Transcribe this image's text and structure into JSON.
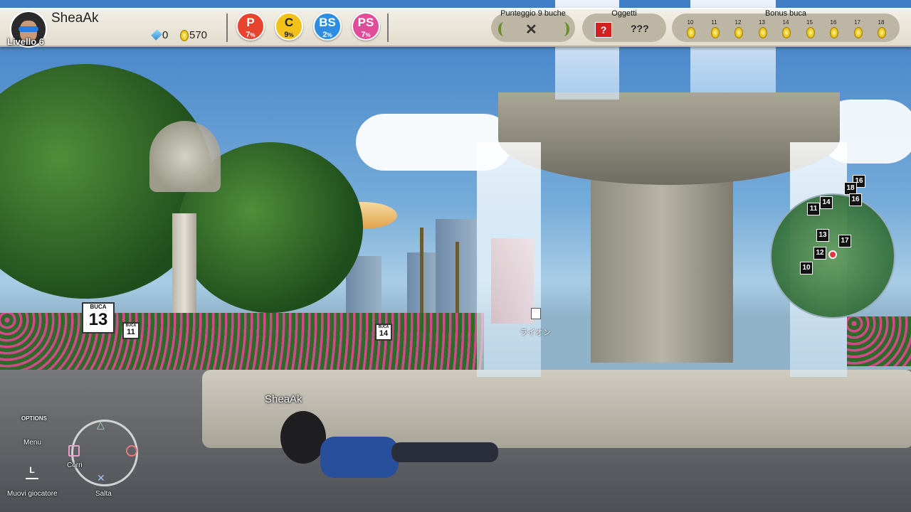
{
  "player": {
    "name": "SheaAk",
    "level_label": "Livello 6",
    "gems": "0",
    "coins": "570",
    "avatar_icon": "player-avatar-sunglasses"
  },
  "stats": [
    {
      "letter": "P",
      "value": "7",
      "unit": "%",
      "color": "#e8432f"
    },
    {
      "letter": "C",
      "value": "9",
      "unit": "%",
      "color": "#f3c21a"
    },
    {
      "letter": "BS",
      "value": "2",
      "unit": "%",
      "color": "#2e8de0"
    },
    {
      "letter": "PS",
      "value": "7",
      "unit": "%",
      "color": "#e04b9a"
    }
  ],
  "score_panel": {
    "label": "Punteggio 9 buche",
    "value_icon": "cross-icon"
  },
  "items_panel": {
    "label": "Oggetti",
    "item_icon": "question-block-icon",
    "value": "???"
  },
  "bonus_panel": {
    "label": "Bonus buca",
    "holes": [
      "10",
      "11",
      "12",
      "13",
      "14",
      "15",
      "16",
      "17",
      "18"
    ]
  },
  "world": {
    "player_tag": "SheaAk",
    "npc_name": "ライオン",
    "sign_big": {
      "caption": "BUCA",
      "number": "13"
    },
    "sign_small": [
      {
        "caption": "BUCA",
        "number": "11"
      },
      {
        "caption": "BUCA",
        "number": "14"
      }
    ]
  },
  "minimap": {
    "markers": [
      "16",
      "18",
      "16",
      "11",
      "14",
      "13",
      "17",
      "12",
      "10"
    ]
  },
  "controls": {
    "options_label": "OPTIONS",
    "menu_label": "Menu",
    "run_label": "Corri",
    "jump_label": "Salta",
    "move_label": "Muovi giocatore",
    "l_label": "L"
  }
}
